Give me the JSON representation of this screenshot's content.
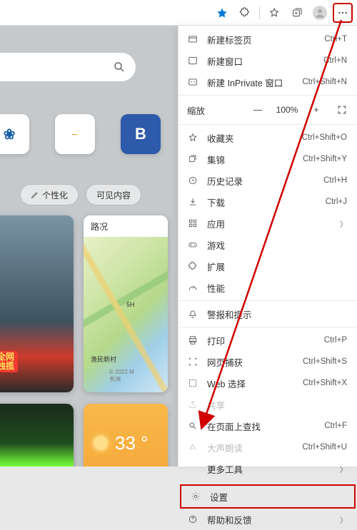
{
  "toolbar": {
    "star": "★",
    "puzzle": "puzzle",
    "favorites": "favorites",
    "collections": "collections",
    "profile": "profile",
    "more": "⋯"
  },
  "background": {
    "tiles": [
      "❀",
      "—",
      "B"
    ],
    "chip_personalize": "个性化",
    "chip_visible": "可见内容",
    "media_badge": "全网\n独揽",
    "map_title": "路况",
    "map_label1": "5H",
    "map_label2": "渔民新村",
    "map_label3": "© 2022 M\n长洲",
    "weather_temp": "33 °"
  },
  "zoom": {
    "label": "缩放",
    "minus": "—",
    "value": "100%",
    "plus": "+",
    "full": "⤢"
  },
  "menu": [
    {
      "icon": "tab",
      "label": "新建标签页",
      "shortcut": "Ctrl+T"
    },
    {
      "icon": "window",
      "label": "新建窗口",
      "shortcut": "Ctrl+N"
    },
    {
      "icon": "inprivate",
      "label": "新建 InPrivate 窗口",
      "shortcut": "Ctrl+Shift+N"
    }
  ],
  "menu2": [
    {
      "icon": "fav",
      "label": "收藏夹",
      "shortcut": "Ctrl+Shift+O"
    },
    {
      "icon": "coll",
      "label": "集锦",
      "shortcut": "Ctrl+Shift+Y"
    },
    {
      "icon": "history",
      "label": "历史记录",
      "shortcut": "Ctrl+H"
    },
    {
      "icon": "download",
      "label": "下载",
      "shortcut": "Ctrl+J"
    },
    {
      "icon": "apps",
      "label": "应用",
      "sub": true
    },
    {
      "icon": "games",
      "label": "游戏"
    },
    {
      "icon": "ext",
      "label": "扩展"
    },
    {
      "icon": "perf",
      "label": "性能"
    }
  ],
  "menu3": [
    {
      "icon": "alert",
      "label": "警报和提示"
    }
  ],
  "menu4": [
    {
      "icon": "print",
      "label": "打印",
      "shortcut": "Ctrl+P"
    },
    {
      "icon": "capture",
      "label": "网页捕获",
      "shortcut": "Ctrl+Shift+S"
    },
    {
      "icon": "select",
      "label": "Web 选择",
      "shortcut": "Ctrl+Shift+X"
    },
    {
      "icon": "share",
      "label": "共享",
      "disabled": true
    },
    {
      "icon": "find",
      "label": "在页面上查找",
      "shortcut": "Ctrl+F"
    },
    {
      "icon": "read",
      "label": "大声朗读",
      "shortcut": "Ctrl+Shift+U",
      "disabled": true
    },
    {
      "icon": "more",
      "label": "更多工具",
      "sub": true
    }
  ],
  "menu5": [
    {
      "icon": "settings",
      "label": "设置",
      "boxed": true
    },
    {
      "icon": "help",
      "label": "帮助和反馈",
      "sub": true
    }
  ]
}
